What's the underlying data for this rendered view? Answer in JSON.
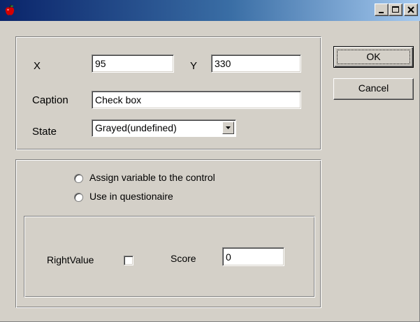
{
  "window": {
    "icon": "apple-icon",
    "controls": {
      "minimize": "minimize-icon",
      "maximize": "maximize-icon",
      "close": "close-icon"
    }
  },
  "properties": {
    "x_label": "X",
    "x_value": "95",
    "y_label": "Y",
    "y_value": "330",
    "caption_label": "Caption",
    "caption_value": "Check box",
    "state_label": "State",
    "state_value": "Grayed(undefined)"
  },
  "options": {
    "assign_variable_label": "Assign variable to the control",
    "use_questionnaire_label": "Use in questionaire"
  },
  "scoring": {
    "right_value_label": "RightValue",
    "score_label": "Score",
    "score_value": "0"
  },
  "buttons": {
    "ok_label": "OK",
    "cancel_label": "Cancel"
  },
  "colors": {
    "face": "#d4d0c8",
    "title_start": "#0a246a",
    "title_end": "#a6caf0"
  }
}
